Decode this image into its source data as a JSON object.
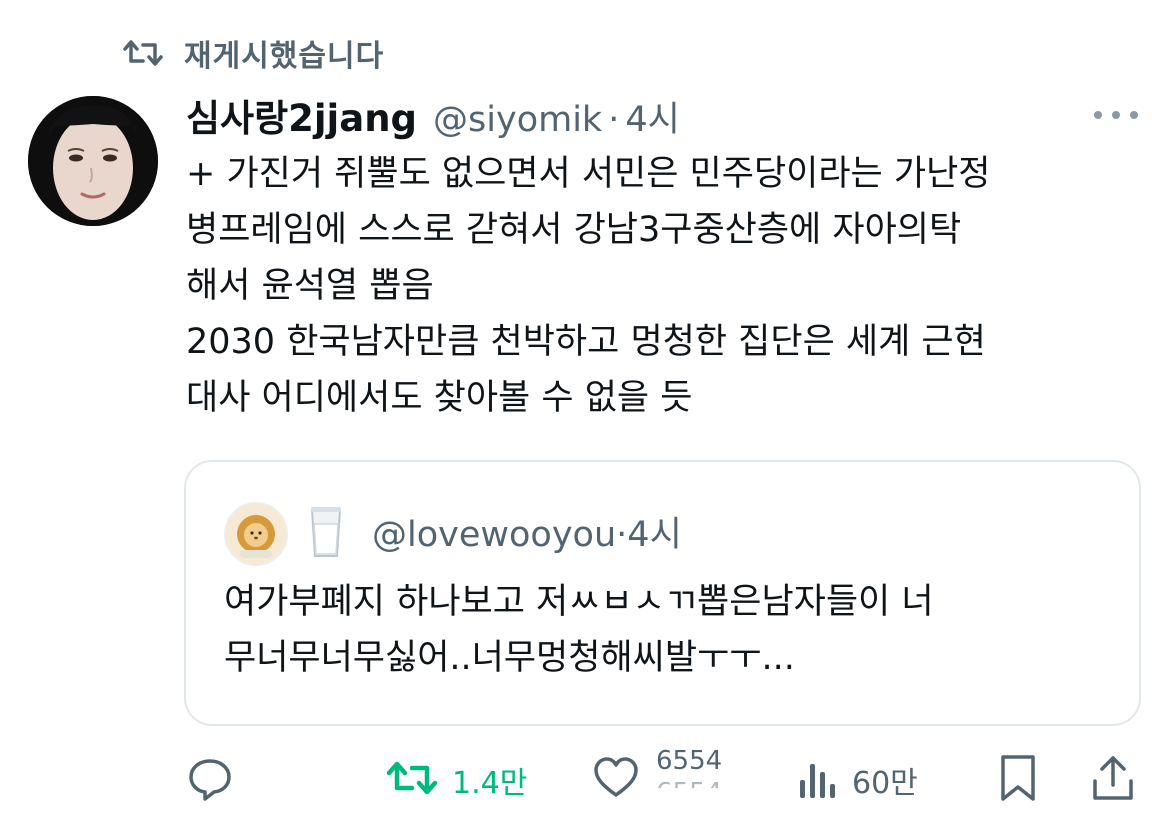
{
  "repost_banner": {
    "text": "재게시했습니다"
  },
  "tweet": {
    "display_name": "심사랑2jjang",
    "handle": "@siyomik",
    "separator": "·",
    "time": "4시",
    "lines": [
      "+ 가진거 쥐뿔도 없으면서 서민은 민주당이라는 가난정",
      "병프레임에 스스로 갇혀서 강남3구중산층에 자아의탁",
      "해서 윤석열 뽑음",
      "2030 한국남자만큼 천박하고 멍청한 집단은 세계 근현",
      "대사 어디에서도 찾아볼 수 없을 듯"
    ]
  },
  "quote": {
    "handle": "@lovewooyou",
    "separator": "·",
    "time": "4시",
    "lines": [
      "여가부폐지 하나보고 저ㅆㅂㅅㄲ뽑은남자들이 너",
      "무너무너무싫어..너무멍청해씨발ㅜㅜ..."
    ]
  },
  "actions": {
    "reposts": "1.4만",
    "likes": "6554",
    "views": "60만"
  },
  "icons": {
    "repost_banner": "repost-icon",
    "more": "more-icon",
    "reply": "reply-icon",
    "repost": "repost-icon",
    "like": "heart-icon",
    "views": "views-icon",
    "bookmark": "bookmark-icon",
    "share": "share-icon",
    "quote_emoji": "milk-icon"
  },
  "colors": {
    "text": "#0f1419",
    "secondary": "#536471",
    "repost_green": "#00ba7c",
    "border": "#e1e8ed"
  }
}
